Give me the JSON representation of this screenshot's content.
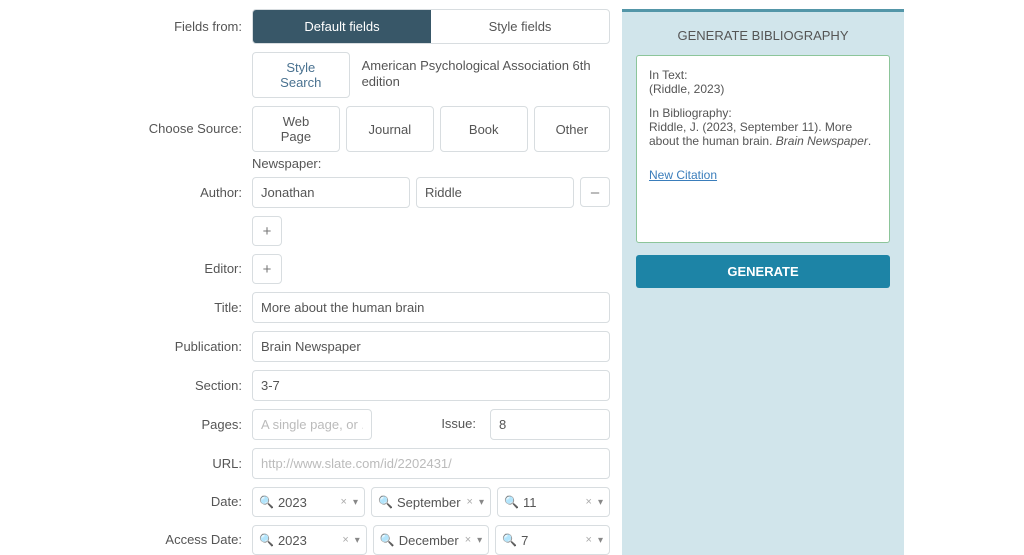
{
  "labels": {
    "fields_from": "Fields from:",
    "choose_source": "Choose Source:",
    "author": "Author:",
    "editor": "Editor:",
    "title": "Title:",
    "publication": "Publication:",
    "section": "Section:",
    "pages": "Pages:",
    "issue": "Issue:",
    "url": "URL:",
    "date": "Date:",
    "access_date": "Access Date:"
  },
  "tabs": {
    "default": "Default fields",
    "style": "Style fields"
  },
  "style_search": "Style Search",
  "style_name": "American Psychological Association 6th edition",
  "source_buttons": {
    "web": "Web Page",
    "journal": "Journal",
    "book": "Book",
    "other": "Other"
  },
  "selected_source": "Newspaper:",
  "author_first": "Jonathan",
  "author_last": "Riddle",
  "title": "More about the human brain",
  "publication": "Brain Newspaper",
  "section": "3-7",
  "pages_value": "",
  "pages_placeholder": "A single page, or ...",
  "issue": "8",
  "url_value": "",
  "url_placeholder": "http://www.slate.com/id/2202431/",
  "date": {
    "year": "2023",
    "month": "September",
    "day": "11"
  },
  "access_date": {
    "year": "2023",
    "month": "December",
    "day": "7"
  },
  "right": {
    "heading": "GENERATE BIBLIOGRAPHY",
    "in_text_label": "In Text:",
    "in_text_value": "(Riddle, 2023)",
    "in_bib_label": "In Bibliography:",
    "in_bib_pre": "Riddle, J. (2023, September 11). More about the human brain. ",
    "in_bib_italic": "Brain Newspaper",
    "in_bib_post": ".",
    "new_citation": "New Citation",
    "generate": "GENERATE"
  },
  "controls": {
    "plus": "+",
    "minus": "–",
    "clear": "×",
    "caret": "▾",
    "search": "🔍"
  }
}
